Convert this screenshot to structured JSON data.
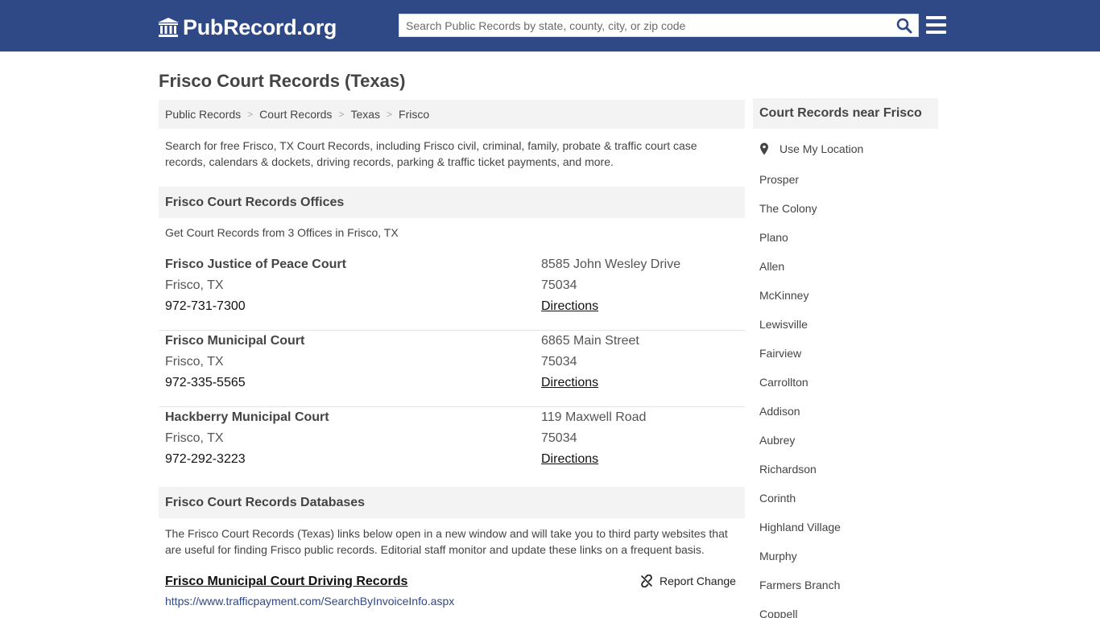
{
  "header": {
    "logo_text": "PubRecord.org",
    "search_placeholder": "Search Public Records by state, county, city, or zip code"
  },
  "page": {
    "title": "Frisco Court Records (Texas)",
    "breadcrumb": [
      "Public Records",
      "Court Records",
      "Texas",
      "Frisco"
    ],
    "intro": "Search for free Frisco, TX Court Records, including Frisco civil, criminal, family, probate & traffic court case records, calendars & dockets, driving records, parking & traffic ticket payments, and more."
  },
  "offices_section": {
    "title": "Frisco Court Records Offices",
    "note": "Get Court Records from 3 Offices in Frisco, TX",
    "offices": [
      {
        "name": "Frisco Justice of Peace Court",
        "city": "Frisco, TX",
        "phone": "972-731-7300",
        "address": "8585 John Wesley Drive",
        "zip": "75034",
        "directions": "Directions"
      },
      {
        "name": "Frisco Municipal Court",
        "city": "Frisco, TX",
        "phone": "972-335-5565",
        "address": "6865 Main Street",
        "zip": "75034",
        "directions": "Directions"
      },
      {
        "name": "Hackberry Municipal Court",
        "city": "Frisco, TX",
        "phone": "972-292-3223",
        "address": "119 Maxwell Road",
        "zip": "75034",
        "directions": "Directions"
      }
    ]
  },
  "databases_section": {
    "title": "Frisco Court Records Databases",
    "note": "The Frisco Court Records (Texas) links below open in a new window and will take you to third party websites that are useful for finding Frisco public records. Editorial staff monitor and update these links on a frequent basis.",
    "items": [
      {
        "title": "Frisco Municipal Court Driving Records",
        "url": "https://www.trafficpayment.com/SearchByInvoiceInfo.aspx",
        "report_label": "Report Change"
      }
    ]
  },
  "sidebar": {
    "title": "Court Records near Frisco",
    "use_location": "Use My Location",
    "cities": [
      "Prosper",
      "The Colony",
      "Plano",
      "Allen",
      "McKinney",
      "Lewisville",
      "Fairview",
      "Carrollton",
      "Addison",
      "Aubrey",
      "Richardson",
      "Corinth",
      "Highland Village",
      "Murphy",
      "Farmers Branch",
      "Coppell"
    ]
  },
  "colors": {
    "header_bg": "#2f4886",
    "panel_bg": "#f3f3f3",
    "text": "#444444",
    "link": "#2f4886"
  }
}
